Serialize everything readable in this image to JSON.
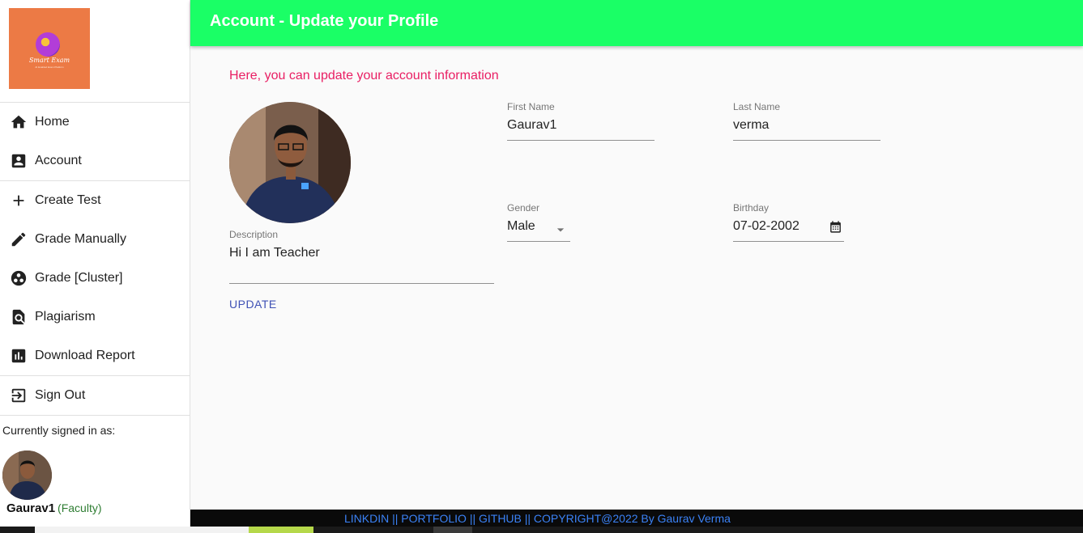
{
  "header": {
    "title": "Account - Update your Profile"
  },
  "logo": {
    "text": "Smart Exam",
    "tagline": "AI Enabled Exam Platform"
  },
  "sidebar": {
    "group1": [
      {
        "label": "Home",
        "icon": "home-icon"
      },
      {
        "label": "Account",
        "icon": "account-box-icon"
      }
    ],
    "group2": [
      {
        "label": "Create Test",
        "icon": "plus-icon"
      },
      {
        "label": "Grade Manually",
        "icon": "pencil-icon"
      },
      {
        "label": "Grade [Cluster]",
        "icon": "cluster-icon"
      },
      {
        "label": "Plagiarism",
        "icon": "find-in-page-icon"
      },
      {
        "label": "Download Report",
        "icon": "bar-chart-icon"
      }
    ],
    "group3": [
      {
        "label": "Sign Out",
        "icon": "exit-icon"
      }
    ],
    "signed_in_label": "Currently signed in as:",
    "user_name": "Gaurav1",
    "user_role": "(Faculty)"
  },
  "main": {
    "intro": "Here, you can update your account information",
    "first_name": {
      "label": "First Name",
      "value": "Gaurav1"
    },
    "last_name": {
      "label": "Last Name",
      "value": "verma"
    },
    "gender": {
      "label": "Gender",
      "value": "Male"
    },
    "birthday": {
      "label": "Birthday",
      "value": "07-02-2002"
    },
    "description": {
      "label": "Description",
      "value": "Hi I am Teacher"
    },
    "update_label": "UPDATE"
  },
  "footer": {
    "text": "LINKDIN || PORTFOLIO || GITHUB || COPYRIGHT@2022 By Gaurav Verma"
  },
  "colors": {
    "appbar": "#1aff66",
    "intro": "#e91e63",
    "button": "#3f51b5",
    "role": "#2e7d32",
    "footer_link": "#3b82f6"
  }
}
